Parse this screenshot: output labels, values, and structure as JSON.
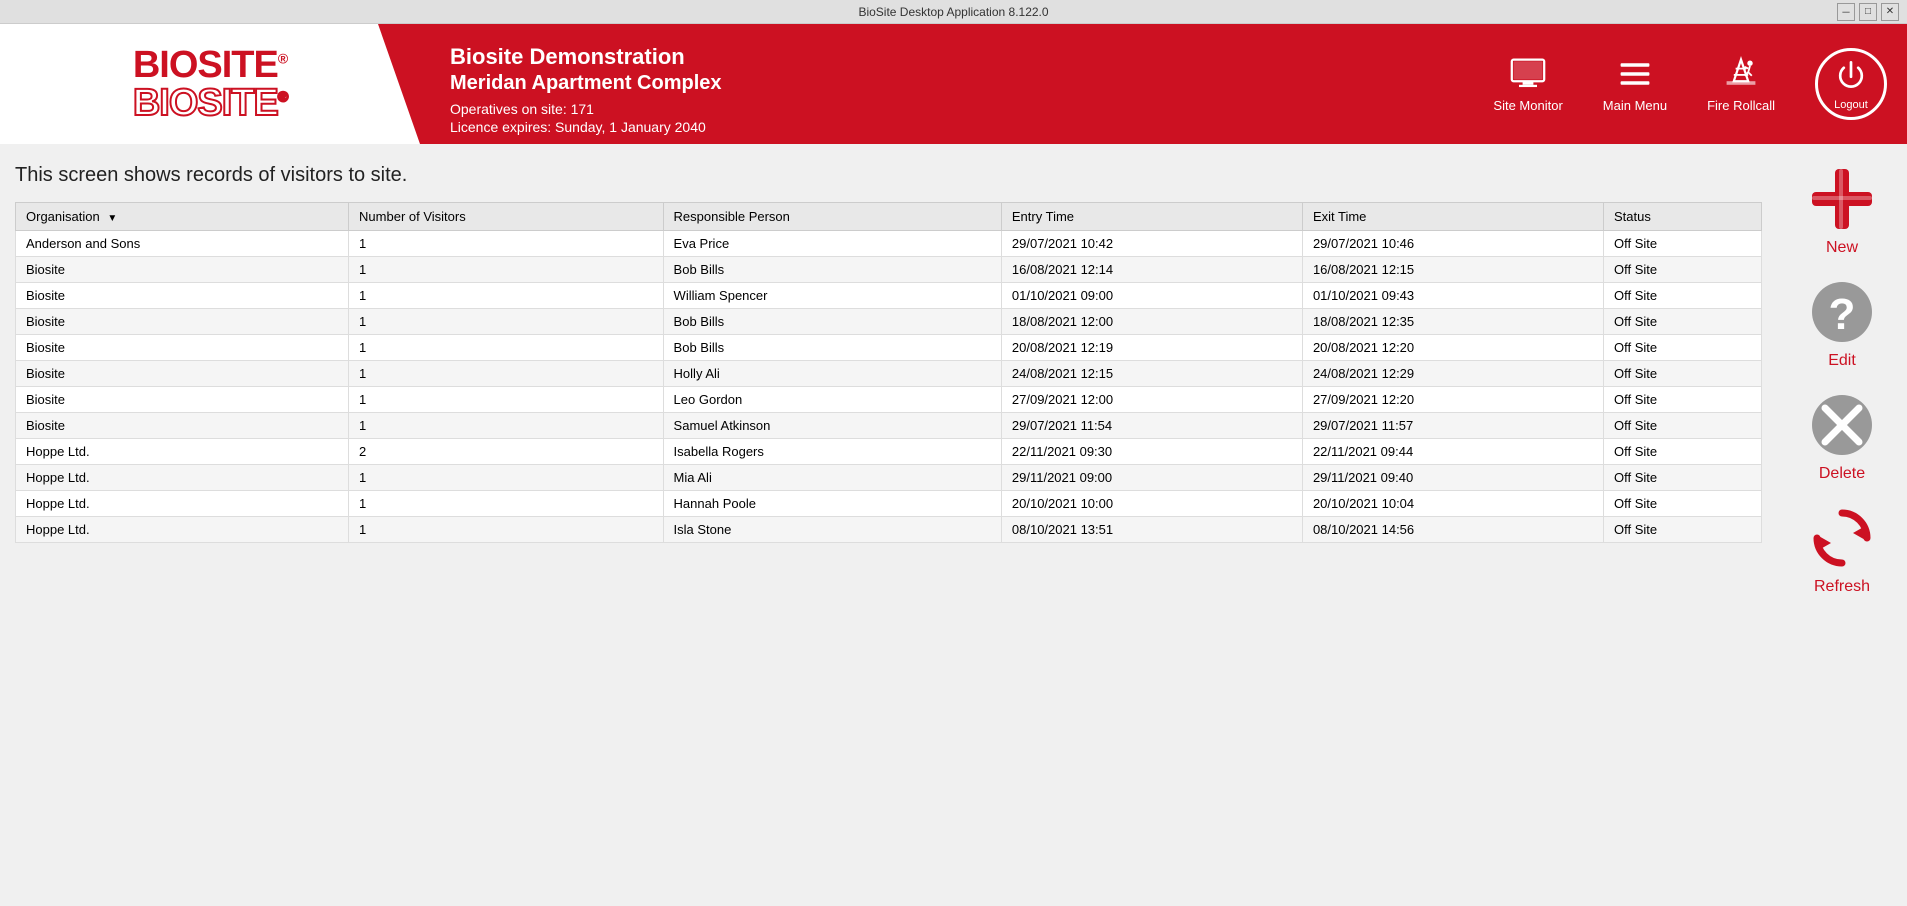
{
  "window": {
    "title": "BioSite Desktop Application 8.122.0"
  },
  "header": {
    "company_name": "Biosite Demonstration",
    "site_name": "Meridan Apartment Complex",
    "operatives": "Operatives on site: 171",
    "licence": "Licence expires: Sunday, 1 January 2040",
    "site_monitor_label": "Site Monitor",
    "main_menu_label": "Main Menu",
    "fire_rollcall_label": "Fire Rollcall",
    "logout_label": "Logout"
  },
  "page": {
    "description": "This screen shows records of visitors to site."
  },
  "table": {
    "columns": [
      "Organisation",
      "Number of Visitors",
      "Responsible Person",
      "Entry Time",
      "Exit Time",
      "Status"
    ],
    "rows": [
      {
        "organisation": "Anderson and Sons",
        "visitors": "1",
        "responsible": "Eva Price",
        "entry": "29/07/2021 10:42",
        "exit": "29/07/2021 10:46",
        "status": "Off Site"
      },
      {
        "organisation": "Biosite",
        "visitors": "1",
        "responsible": "Bob Bills",
        "entry": "16/08/2021 12:14",
        "exit": "16/08/2021 12:15",
        "status": "Off Site"
      },
      {
        "organisation": "Biosite",
        "visitors": "1",
        "responsible": "William Spencer",
        "entry": "01/10/2021 09:00",
        "exit": "01/10/2021 09:43",
        "status": "Off Site"
      },
      {
        "organisation": "Biosite",
        "visitors": "1",
        "responsible": "Bob Bills",
        "entry": "18/08/2021 12:00",
        "exit": "18/08/2021 12:35",
        "status": "Off Site"
      },
      {
        "organisation": "Biosite",
        "visitors": "1",
        "responsible": "Bob Bills",
        "entry": "20/08/2021 12:19",
        "exit": "20/08/2021 12:20",
        "status": "Off Site"
      },
      {
        "organisation": "Biosite",
        "visitors": "1",
        "responsible": "Holly Ali",
        "entry": "24/08/2021 12:15",
        "exit": "24/08/2021 12:29",
        "status": "Off Site"
      },
      {
        "organisation": "Biosite",
        "visitors": "1",
        "responsible": "Leo Gordon",
        "entry": "27/09/2021 12:00",
        "exit": "27/09/2021 12:20",
        "status": "Off Site"
      },
      {
        "organisation": "Biosite",
        "visitors": "1",
        "responsible": "Samuel Atkinson",
        "entry": "29/07/2021 11:54",
        "exit": "29/07/2021 11:57",
        "status": "Off Site"
      },
      {
        "organisation": "Hoppe Ltd.",
        "visitors": "2",
        "responsible": "Isabella Rogers",
        "entry": "22/11/2021 09:30",
        "exit": "22/11/2021 09:44",
        "status": "Off Site"
      },
      {
        "organisation": "Hoppe Ltd.",
        "visitors": "1",
        "responsible": "Mia Ali",
        "entry": "29/11/2021 09:00",
        "exit": "29/11/2021 09:40",
        "status": "Off Site"
      },
      {
        "organisation": "Hoppe Ltd.",
        "visitors": "1",
        "responsible": "Hannah Poole",
        "entry": "20/10/2021 10:00",
        "exit": "20/10/2021 10:04",
        "status": "Off Site"
      },
      {
        "organisation": "Hoppe Ltd.",
        "visitors": "1",
        "responsible": "Isla Stone",
        "entry": "08/10/2021 13:51",
        "exit": "08/10/2021 14:56",
        "status": "Off Site"
      }
    ]
  },
  "actions": {
    "new_label": "New",
    "edit_label": "Edit",
    "delete_label": "Delete",
    "refresh_label": "Refresh"
  }
}
